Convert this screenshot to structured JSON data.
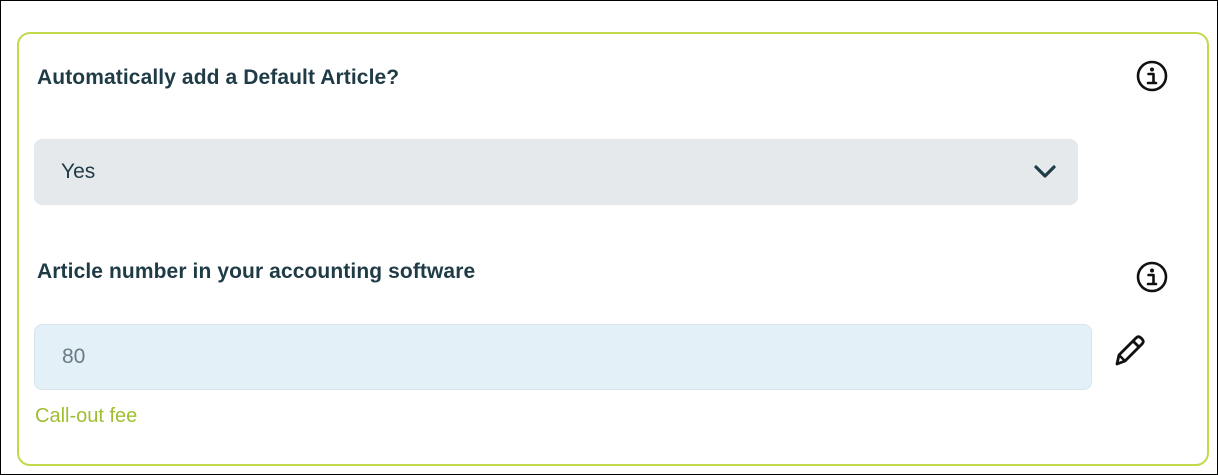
{
  "form": {
    "default_article": {
      "label": "Automatically add a Default Article?",
      "selected_value": "Yes"
    },
    "article_number": {
      "label": "Article number in your accounting software",
      "value": "80",
      "helper_text": "Call-out fee"
    }
  },
  "icons": {
    "info": "info-circle-icon",
    "dropdown": "chevron-down-icon",
    "edit": "pencil-icon"
  },
  "colors": {
    "card_border": "#c3d94a",
    "label_text": "#1f3b46",
    "helper_text": "#9fbe32",
    "select_bg": "#e6e9ec",
    "input_bg": "#e3f0f7"
  }
}
